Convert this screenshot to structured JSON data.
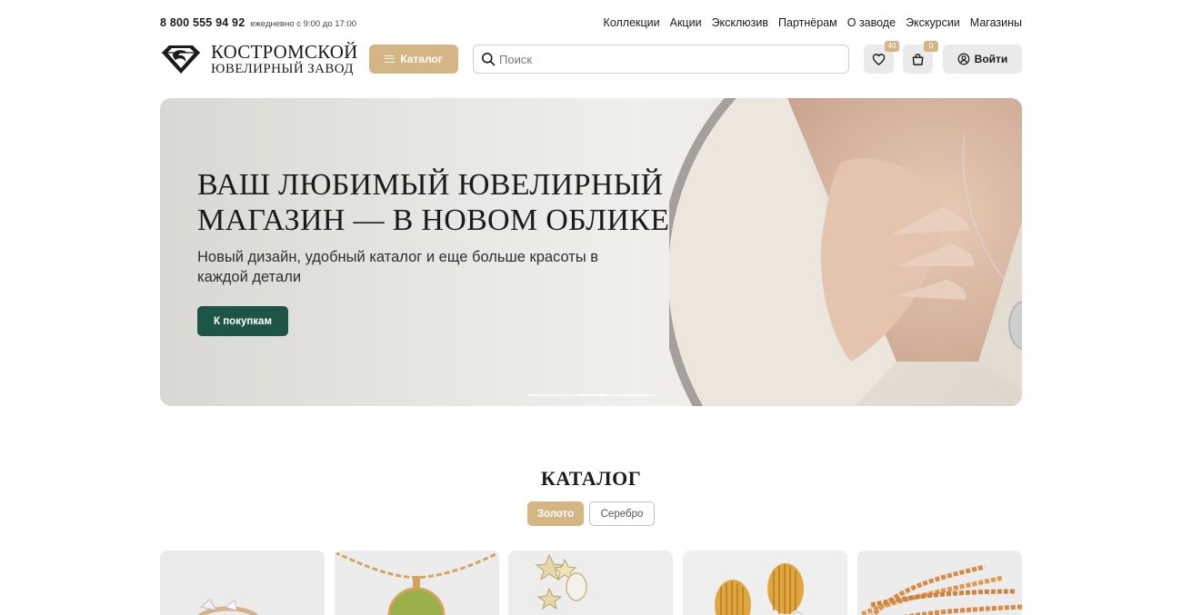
{
  "topbar": {
    "phone": "8 800 555 94 92",
    "hours": "ежедневно с 9:00 до 17:00",
    "nav": [
      "Коллекции",
      "Акции",
      "Эксклюзив",
      "Партнёрам",
      "О заводе",
      "Экскурсии",
      "Магазины"
    ]
  },
  "header": {
    "logo_line1": "КОСТРОМСКОЙ",
    "logo_line2": "ЮВЕЛИРНЫЙ ЗАВОД",
    "catalog_label": "Каталог",
    "search_placeholder": "Поиск",
    "favorites_count": "40",
    "cart_count": "0",
    "login_label": "Войти"
  },
  "hero": {
    "title": "ВАШ ЛЮБИМЫЙ ЮВЕЛИРНЫЙ МАГАЗИН — В НОВОМ ОБЛИКЕ",
    "subtitle": "Новый дизайн, удобный каталог и еще больше красоты в каждой детали",
    "cta": "К покупкам",
    "slides_total": 5,
    "active_slide": 3
  },
  "catalog": {
    "title": "КАТАЛОГ",
    "tabs": [
      "Золото",
      "Серебро"
    ],
    "active_tab": "Золото",
    "cards": [
      "ring",
      "pendant",
      "earrings-stars",
      "earrings-gold",
      "chain"
    ]
  },
  "colors": {
    "accent_gold": "#d6b585",
    "cta_green": "#1d5549",
    "icon_bg": "#eaeaea"
  }
}
